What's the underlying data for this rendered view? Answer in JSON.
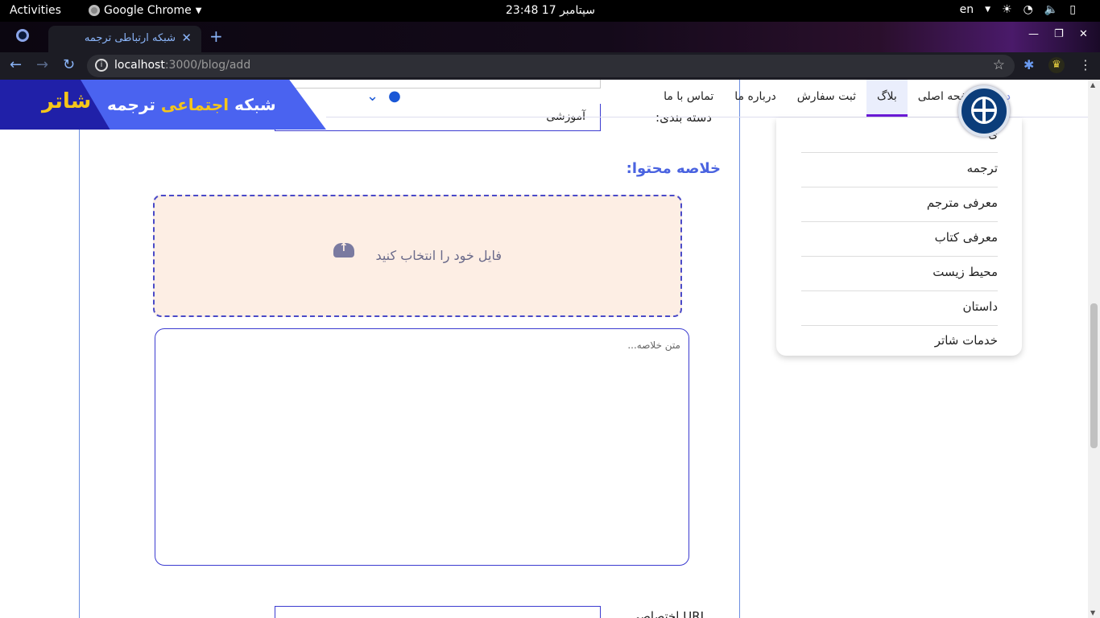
{
  "system_bar": {
    "activities": "Activities",
    "app_name": "Google Chrome",
    "clock": "23:48  17 سپتامبر",
    "language": "en"
  },
  "browser": {
    "tab_title": "شبکه ارتباطی ترجمه",
    "url_host": "localhost",
    "url_rest": ":3000/blog/add"
  },
  "site": {
    "brand_name": "شاتر",
    "brand_sub_a": "شبکه ",
    "brand_sub_b": "اجتماعی ",
    "brand_sub_c": "ترجمه",
    "nav": [
      "صفحه اصلی",
      "بلاگ",
      "ثبت سفارش",
      "درباره ما",
      "تماس با ما"
    ],
    "nav_faded": "دی",
    "active_nav": "بلاگ"
  },
  "dropdown": {
    "items": [
      "ی",
      "ترجمه",
      "معرفی مترجم",
      "معرفی کتاب",
      "محیط زیست",
      "داستان",
      "خدمات شاتر"
    ]
  },
  "form": {
    "category_label": "دسته بندی:",
    "category_value": "آموزشی",
    "summary_title": "خلاصه محتوا:",
    "upload_text": "فایل خود را انتخاب کنید",
    "summary_placeholder": "متن خلاصه...",
    "url_label": "URL اختصاصی"
  },
  "colors": {
    "brand_blue": "#4a63f0",
    "brand_dark": "#2020a8",
    "brand_yellow": "#f5c61a",
    "active_underline": "#6a1ad6"
  }
}
